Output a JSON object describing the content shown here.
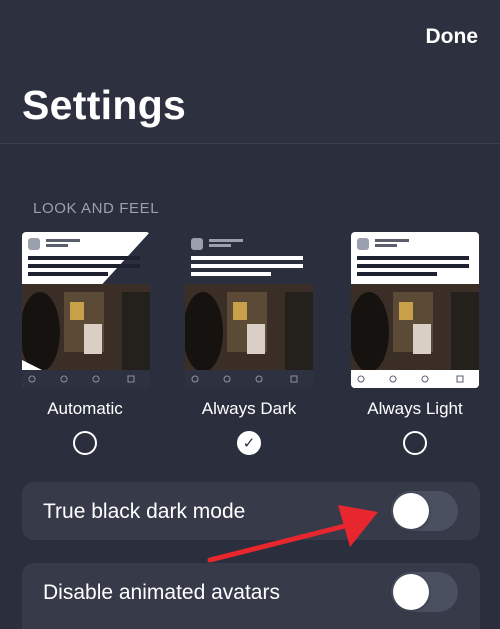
{
  "header": {
    "done_label": "Done",
    "title": "Settings"
  },
  "section": {
    "label": "LOOK AND FEEL"
  },
  "themes": [
    {
      "label": "Automatic",
      "selected": false
    },
    {
      "label": "Always Dark",
      "selected": true
    },
    {
      "label": "Always Light",
      "selected": false
    }
  ],
  "toggles": [
    {
      "label": "True black dark mode",
      "on": false
    },
    {
      "label": "Disable animated avatars",
      "on": false
    }
  ],
  "colors": {
    "background": "#2b2f3d",
    "row": "#363a49",
    "toggle_off": "#4b5060",
    "annotation_arrow": "#e8262e"
  },
  "icons": {
    "checkmark": "checkmark-icon",
    "arrow": "annotation-arrow-icon"
  }
}
